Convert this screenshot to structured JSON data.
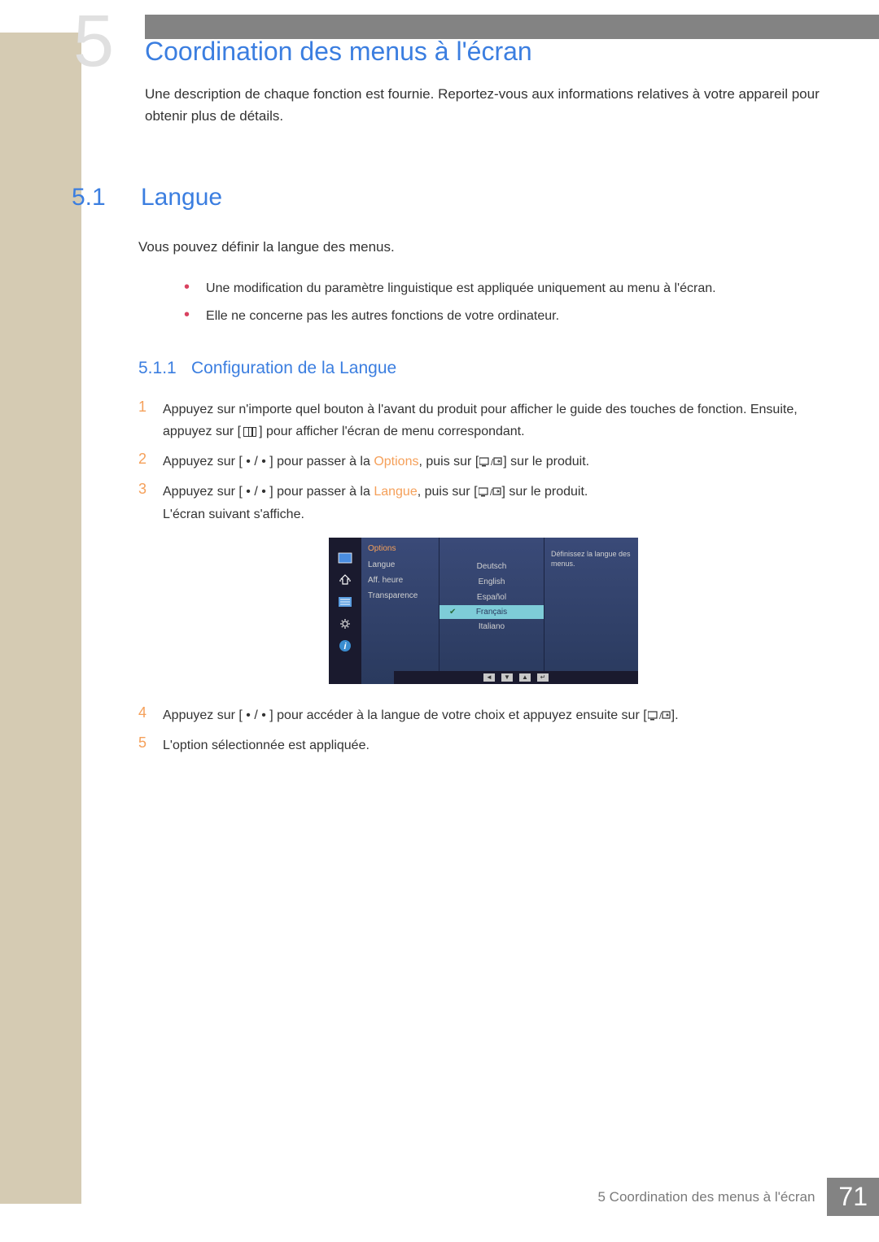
{
  "chapter": {
    "num": "5",
    "title": "Coordination des menus à l'écran",
    "intro": "Une description de chaque fonction est fournie. Reportez-vous aux informations relatives à votre appareil pour obtenir plus de détails."
  },
  "section": {
    "num": "5.1",
    "title": "Langue",
    "text": "Vous pouvez définir la langue des menus.",
    "bullets": [
      "Une modification du paramètre linguistique est appliquée uniquement au menu à l'écran.",
      "Elle ne concerne pas les autres fonctions de votre ordinateur."
    ]
  },
  "subsection": {
    "num": "5.1.1",
    "title": "Configuration de la Langue"
  },
  "steps": [
    {
      "n": "1",
      "pre": "Appuyez sur n'importe quel bouton à l'avant du produit pour afficher le guide des touches de fonction. Ensuite, appuyez sur [",
      "post": "] pour afficher l'écran de menu correspondant."
    },
    {
      "n": "2",
      "pre": "Appuyez sur [ • / • ] pour passer à la ",
      "hl": "Options",
      "mid": ", puis sur [",
      "post": "] sur le produit."
    },
    {
      "n": "3",
      "pre": "Appuyez sur [ • / • ] pour passer à la ",
      "hl": "Langue",
      "mid": ", puis sur [",
      "post": "] sur le produit.",
      "extra": "L'écran suivant s'affiche."
    },
    {
      "n": "4",
      "pre": "Appuyez sur [ • / • ] pour accéder à la langue de votre choix et appuyez ensuite sur [",
      "post": "]."
    },
    {
      "n": "5",
      "pre": "L'option sélectionnée est appliquée."
    }
  ],
  "osd": {
    "header": "Options",
    "menu": [
      "Langue",
      "Aff. heure",
      "Transparence"
    ],
    "languages": [
      "Deutsch",
      "English",
      "Español",
      "Français",
      "Italiano"
    ],
    "selected": "Français",
    "help": "Définissez la langue des menus.",
    "footer_icons": [
      "◄",
      "▼",
      "▲",
      "↵"
    ]
  },
  "footer": {
    "text": "5 Coordination des menus à l'écran",
    "page": "71"
  }
}
